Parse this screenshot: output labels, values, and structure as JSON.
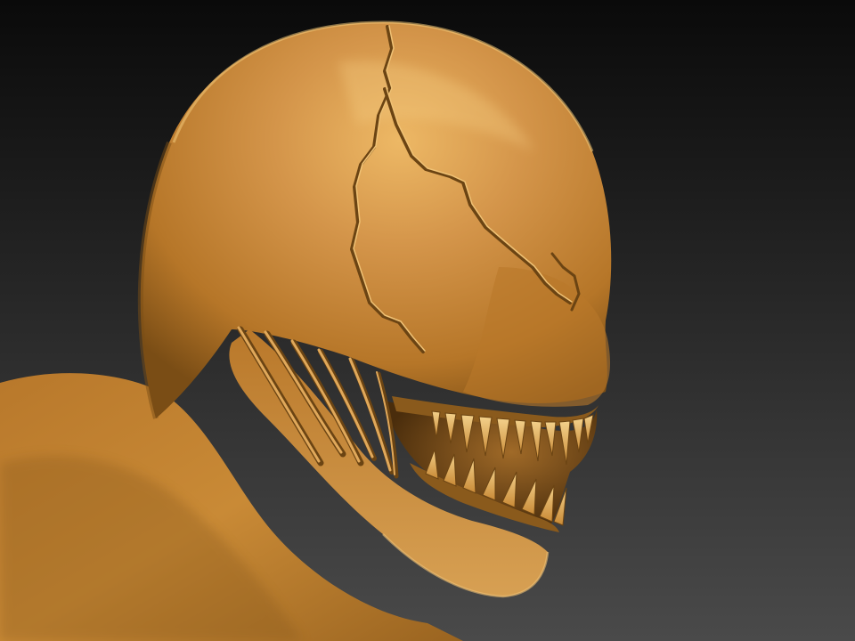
{
  "scene": {
    "background": {
      "top": "#0a0a0a",
      "bottom": "#4a4a4a"
    },
    "material": {
      "base": "#c98a36",
      "highlight": "#e8b25c",
      "shadow": "#6b4413",
      "deep_shadow": "#3d2508",
      "rim": "#f2c878"
    },
    "subject": "sculpted-creature-head-bust"
  }
}
